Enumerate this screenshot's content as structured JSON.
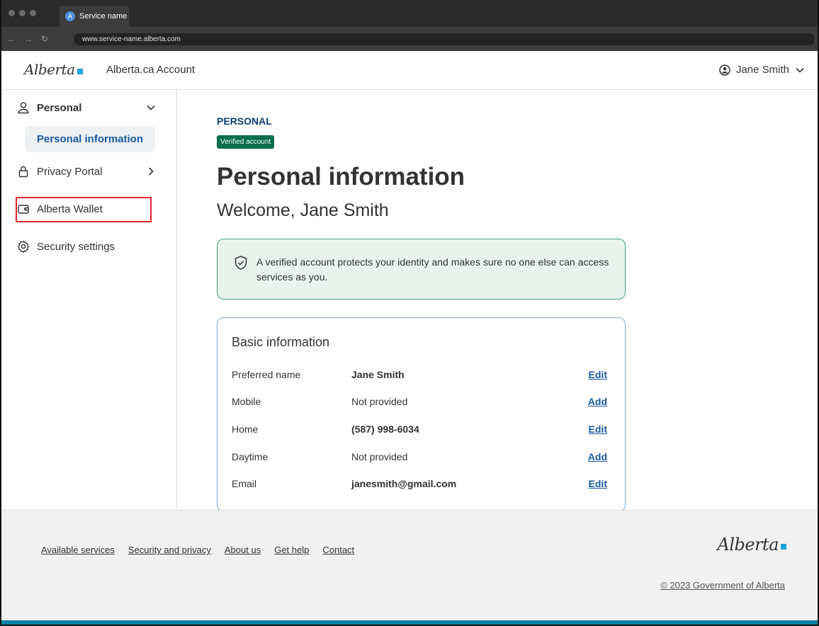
{
  "browser": {
    "tab_title": "Service name",
    "url": "www.service-name.alberta.com"
  },
  "header": {
    "logo_text": "Alberta",
    "app_name": "Alberta.ca Account",
    "user_name": "Jane Smith"
  },
  "sidebar": {
    "group_label": "Personal",
    "sub_item": "Personal information",
    "privacy": "Privacy Portal",
    "wallet": "Alberta Wallet",
    "security": "Security settings"
  },
  "main": {
    "eyebrow": "PERSONAL",
    "badge": "Verified account",
    "title": "Personal information",
    "welcome": "Welcome, Jane Smith",
    "callout": "A verified account protects your identity and makes sure no one else can access services as you.",
    "card_title": "Basic information",
    "rows": [
      {
        "label": "Preferred name",
        "value": "Jane Smith",
        "action": "Edit"
      },
      {
        "label": "Mobile",
        "value": "Not provided",
        "action": "Add"
      },
      {
        "label": "Home",
        "value": "(587) 998-6034",
        "action": "Edit"
      },
      {
        "label": "Daytime",
        "value": "Not provided",
        "action": "Add"
      },
      {
        "label": "Email",
        "value": "janesmith@gmail.com",
        "action": "Edit"
      }
    ]
  },
  "footer": {
    "links": [
      "Available services",
      "Security and privacy",
      "About us",
      "Get help",
      "Contact"
    ],
    "logo_text": "Alberta",
    "copyright": "© 2023 Government of Alberta"
  },
  "colors": {
    "accent_blue": "#1b5aa3",
    "badge_green": "#006f4a",
    "highlight_red": "#e0232f",
    "footer_bar": "#0081a2"
  }
}
